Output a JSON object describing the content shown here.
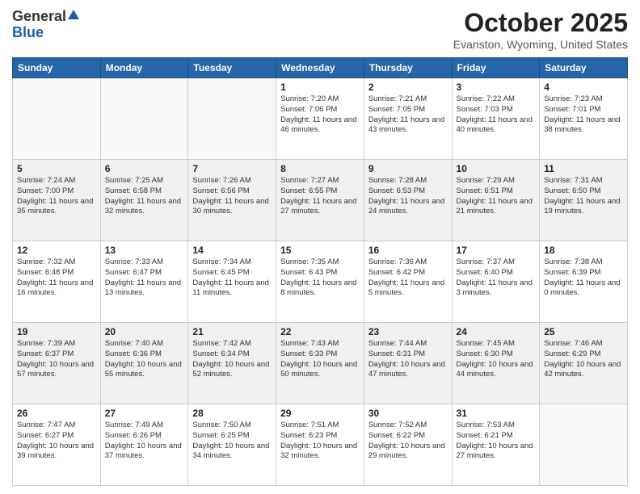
{
  "header": {
    "logo_general": "General",
    "logo_blue": "Blue",
    "month_title": "October 2025",
    "location": "Evanston, Wyoming, United States"
  },
  "days_of_week": [
    "Sunday",
    "Monday",
    "Tuesday",
    "Wednesday",
    "Thursday",
    "Friday",
    "Saturday"
  ],
  "weeks": [
    [
      {
        "day": "",
        "info": "",
        "empty": true
      },
      {
        "day": "",
        "info": "",
        "empty": true
      },
      {
        "day": "",
        "info": "",
        "empty": true
      },
      {
        "day": "1",
        "info": "Sunrise: 7:20 AM\nSunset: 7:06 PM\nDaylight: 11 hours and 46 minutes."
      },
      {
        "day": "2",
        "info": "Sunrise: 7:21 AM\nSunset: 7:05 PM\nDaylight: 11 hours and 43 minutes."
      },
      {
        "day": "3",
        "info": "Sunrise: 7:22 AM\nSunset: 7:03 PM\nDaylight: 11 hours and 40 minutes."
      },
      {
        "day": "4",
        "info": "Sunrise: 7:23 AM\nSunset: 7:01 PM\nDaylight: 11 hours and 38 minutes."
      }
    ],
    [
      {
        "day": "5",
        "info": "Sunrise: 7:24 AM\nSunset: 7:00 PM\nDaylight: 11 hours and 35 minutes."
      },
      {
        "day": "6",
        "info": "Sunrise: 7:25 AM\nSunset: 6:58 PM\nDaylight: 11 hours and 32 minutes."
      },
      {
        "day": "7",
        "info": "Sunrise: 7:26 AM\nSunset: 6:56 PM\nDaylight: 11 hours and 30 minutes."
      },
      {
        "day": "8",
        "info": "Sunrise: 7:27 AM\nSunset: 6:55 PM\nDaylight: 11 hours and 27 minutes."
      },
      {
        "day": "9",
        "info": "Sunrise: 7:28 AM\nSunset: 6:53 PM\nDaylight: 11 hours and 24 minutes."
      },
      {
        "day": "10",
        "info": "Sunrise: 7:29 AM\nSunset: 6:51 PM\nDaylight: 11 hours and 21 minutes."
      },
      {
        "day": "11",
        "info": "Sunrise: 7:31 AM\nSunset: 6:50 PM\nDaylight: 11 hours and 19 minutes."
      }
    ],
    [
      {
        "day": "12",
        "info": "Sunrise: 7:32 AM\nSunset: 6:48 PM\nDaylight: 11 hours and 16 minutes."
      },
      {
        "day": "13",
        "info": "Sunrise: 7:33 AM\nSunset: 6:47 PM\nDaylight: 11 hours and 13 minutes."
      },
      {
        "day": "14",
        "info": "Sunrise: 7:34 AM\nSunset: 6:45 PM\nDaylight: 11 hours and 11 minutes."
      },
      {
        "day": "15",
        "info": "Sunrise: 7:35 AM\nSunset: 6:43 PM\nDaylight: 11 hours and 8 minutes."
      },
      {
        "day": "16",
        "info": "Sunrise: 7:36 AM\nSunset: 6:42 PM\nDaylight: 11 hours and 5 minutes."
      },
      {
        "day": "17",
        "info": "Sunrise: 7:37 AM\nSunset: 6:40 PM\nDaylight: 11 hours and 3 minutes."
      },
      {
        "day": "18",
        "info": "Sunrise: 7:38 AM\nSunset: 6:39 PM\nDaylight: 11 hours and 0 minutes."
      }
    ],
    [
      {
        "day": "19",
        "info": "Sunrise: 7:39 AM\nSunset: 6:37 PM\nDaylight: 10 hours and 57 minutes."
      },
      {
        "day": "20",
        "info": "Sunrise: 7:40 AM\nSunset: 6:36 PM\nDaylight: 10 hours and 55 minutes."
      },
      {
        "day": "21",
        "info": "Sunrise: 7:42 AM\nSunset: 6:34 PM\nDaylight: 10 hours and 52 minutes."
      },
      {
        "day": "22",
        "info": "Sunrise: 7:43 AM\nSunset: 6:33 PM\nDaylight: 10 hours and 50 minutes."
      },
      {
        "day": "23",
        "info": "Sunrise: 7:44 AM\nSunset: 6:31 PM\nDaylight: 10 hours and 47 minutes."
      },
      {
        "day": "24",
        "info": "Sunrise: 7:45 AM\nSunset: 6:30 PM\nDaylight: 10 hours and 44 minutes."
      },
      {
        "day": "25",
        "info": "Sunrise: 7:46 AM\nSunset: 6:29 PM\nDaylight: 10 hours and 42 minutes."
      }
    ],
    [
      {
        "day": "26",
        "info": "Sunrise: 7:47 AM\nSunset: 6:27 PM\nDaylight: 10 hours and 39 minutes."
      },
      {
        "day": "27",
        "info": "Sunrise: 7:49 AM\nSunset: 6:26 PM\nDaylight: 10 hours and 37 minutes."
      },
      {
        "day": "28",
        "info": "Sunrise: 7:50 AM\nSunset: 6:25 PM\nDaylight: 10 hours and 34 minutes."
      },
      {
        "day": "29",
        "info": "Sunrise: 7:51 AM\nSunset: 6:23 PM\nDaylight: 10 hours and 32 minutes."
      },
      {
        "day": "30",
        "info": "Sunrise: 7:52 AM\nSunset: 6:22 PM\nDaylight: 10 hours and 29 minutes."
      },
      {
        "day": "31",
        "info": "Sunrise: 7:53 AM\nSunset: 6:21 PM\nDaylight: 10 hours and 27 minutes."
      },
      {
        "day": "",
        "info": "",
        "empty": true
      }
    ]
  ]
}
